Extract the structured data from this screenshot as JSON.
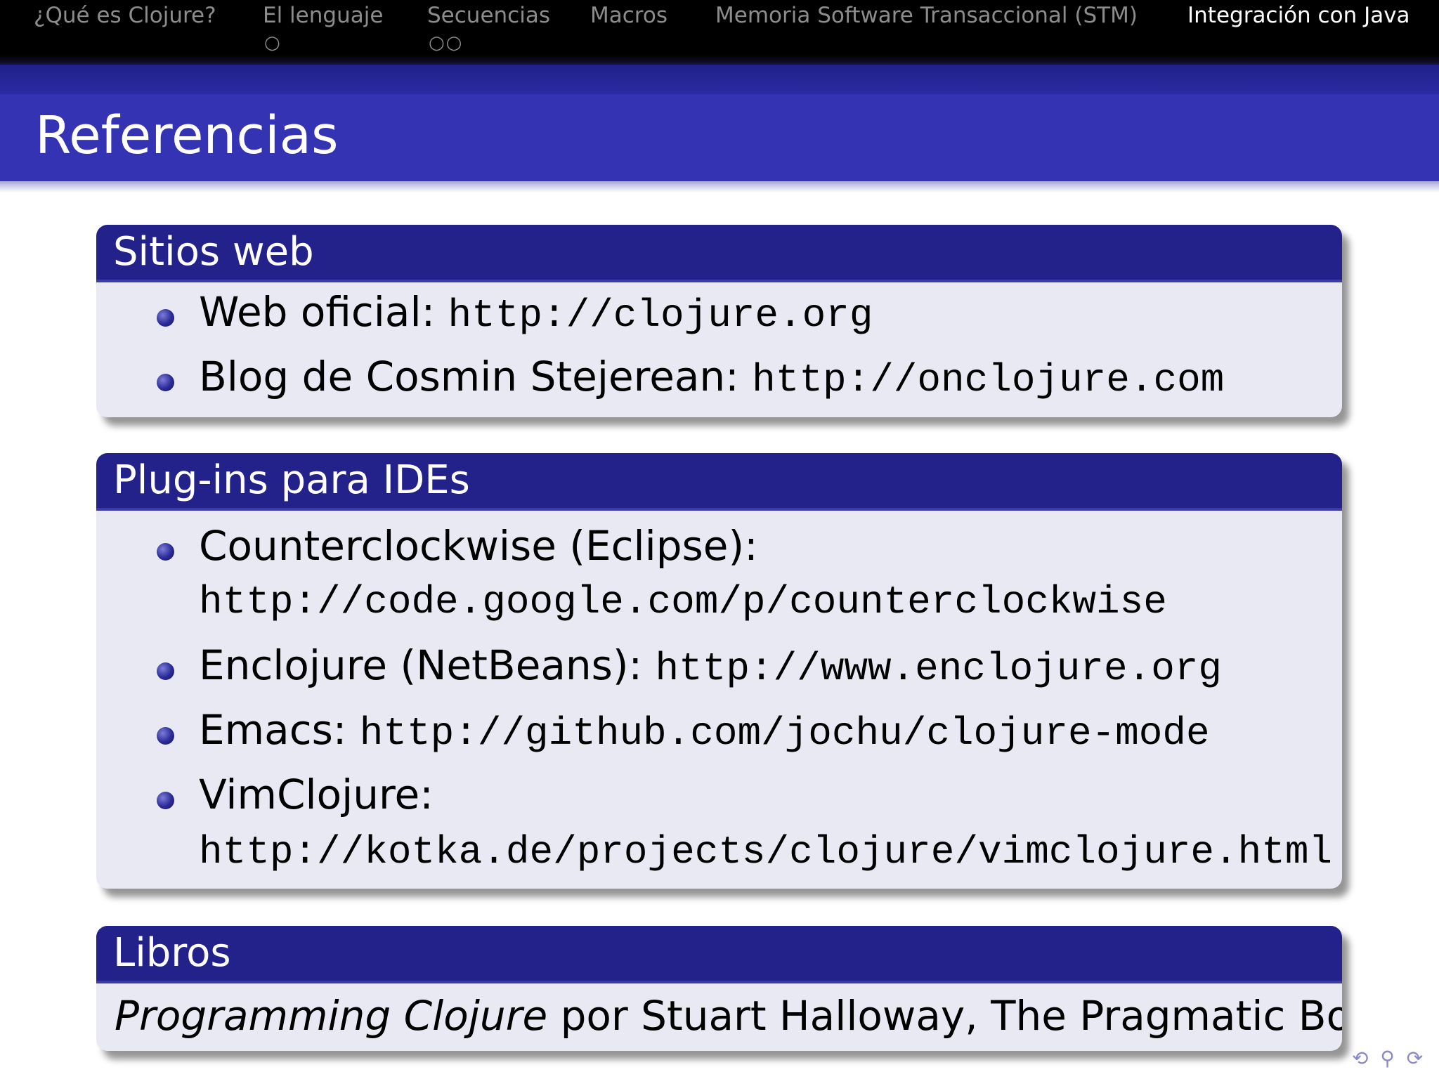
{
  "nav": {
    "items": [
      {
        "label": "¿Qué es Clojure?",
        "dots": ""
      },
      {
        "label": "El lenguaje",
        "dots": "○"
      },
      {
        "label": "Secuencias",
        "dots": "○○"
      },
      {
        "label": "Macros",
        "dots": ""
      },
      {
        "label": "Memoria Software Transaccional (STM)",
        "dots": ""
      },
      {
        "label": "Integración con Java",
        "dots": ""
      }
    ],
    "active_index": 5
  },
  "slide": {
    "title": "Referencias"
  },
  "blocks": {
    "sitios": {
      "title": "Sitios web",
      "items": [
        {
          "text": "Web oficial: ",
          "url": "http://clojure.org"
        },
        {
          "text": "Blog de Cosmin Stejerean: ",
          "url": "http://onclojure.com"
        }
      ]
    },
    "plugins": {
      "title": "Plug-ins para IDEs",
      "items": [
        {
          "text": "Counterclockwise (Eclipse):",
          "url": "http://code.google.com/p/counterclockwise"
        },
        {
          "text": "Enclojure (NetBeans): ",
          "url": "http://www.enclojure.org"
        },
        {
          "text": "Emacs: ",
          "url": "http://github.com/jochu/clojure-mode"
        },
        {
          "text": "VimClojure:",
          "url": "http://kotka.de/projects/clojure/vimclojure.html"
        }
      ]
    },
    "libros": {
      "title": "Libros",
      "book_title": "Programming Clojure",
      "book_rest": " por Stuart Halloway, The Pragmatic Bookshelf"
    }
  },
  "nav_symbols": "⟲ ⚲ ⟳",
  "colors": {
    "nav_bg": "#000000",
    "title_bg": "#3333b3",
    "block_head_bg": "#22228a",
    "block_body_bg": "#e9e9f3"
  }
}
